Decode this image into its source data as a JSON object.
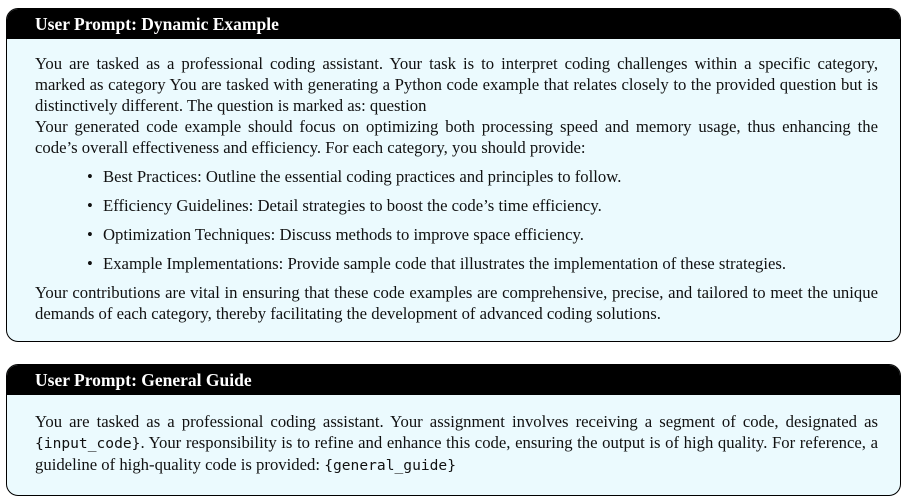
{
  "dynamic_example": {
    "title": "User Prompt: Dynamic Example",
    "intro": "You are tasked as a professional coding assistant. Your task is to interpret coding challenges within a specific category, marked as category You are tasked with generating a Python code example that relates closely to the provided question but is distinctively different. The question is marked as: question",
    "focus": "Your generated code example should focus on optimizing both processing speed and memory usage, thus enhancing the code’s overall effectiveness and efficiency. For each category, you should provide:",
    "items": [
      "Best Practices: Outline the essential coding practices and principles to follow.",
      "Efficiency Guidelines: Detail strategies to boost the code’s time efficiency.",
      "Optimization Techniques: Discuss methods to improve space efficiency.",
      "Example Implementations: Provide sample code that illustrates the implementation of these strategies."
    ],
    "closing": "Your contributions are vital in ensuring that these code examples are comprehensive, precise, and tailored to meet the unique demands of each category, thereby facilitating the development of advanced coding solutions."
  },
  "general_guide": {
    "title": "User Prompt: General Guide",
    "text_1": "You are tasked as a professional coding assistant. Your assignment involves receiving a segment of code, designated as ",
    "code_input": "{input_code}",
    "text_2": ". Your responsibility is to refine and enhance this code, ensuring the output is of high quality. For reference, a guideline of high-quality code is provided: ",
    "code_guide": "{general_guide}"
  }
}
